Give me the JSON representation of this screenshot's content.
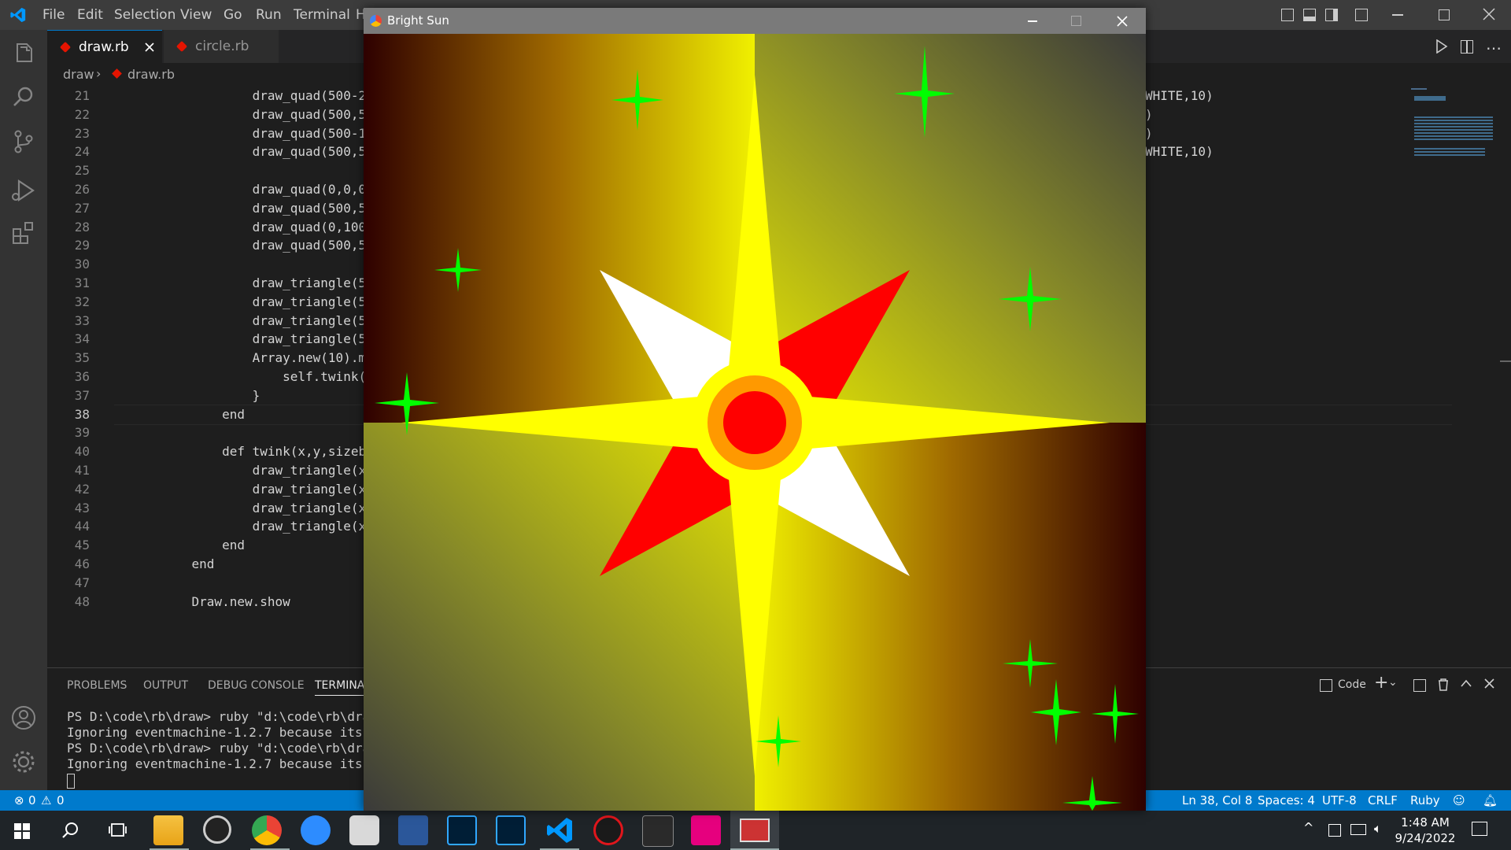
{
  "menu": [
    "File",
    "Edit",
    "Selection",
    "View",
    "Go",
    "Run",
    "Terminal",
    "H"
  ],
  "tabs": [
    {
      "label": "draw.rb",
      "active": true
    },
    {
      "label": "circle.rb",
      "active": false
    }
  ],
  "breadcrumb": {
    "folder": "draw",
    "file": "draw.rb"
  },
  "code": [
    {
      "n": "21",
      "t": "            draw_quad(500-200,500-200"
    },
    {
      "n": "22",
      "t": "            draw_quad(500,500-100,Gos"
    },
    {
      "n": "23",
      "t": "            draw_quad(500-100,500,Gos"
    },
    {
      "n": "24",
      "t": "            draw_quad(500,500,Gosu::C"
    },
    {
      "n": "25",
      "t": ""
    },
    {
      "n": "26",
      "t": "            draw_quad(0,0,0xff_330000"
    },
    {
      "n": "27",
      "t": "            draw_quad(500,500,Gosu::C"
    },
    {
      "n": "28",
      "t": "            draw_quad(0,1000,0xff_333"
    },
    {
      "n": "29",
      "t": "            draw_quad(500,500,Gosu::C"
    },
    {
      "n": "30",
      "t": ""
    },
    {
      "n": "31",
      "t": "            draw_triangle(500,500-50,"
    },
    {
      "n": "32",
      "t": "            draw_triangle(500-50,500,"
    },
    {
      "n": "33",
      "t": "            draw_triangle(500,500-50,"
    },
    {
      "n": "34",
      "t": "            draw_triangle(500-50,500,"
    },
    {
      "n": "35",
      "t": "            Array.new(10).map() {"
    },
    {
      "n": "36",
      "t": "                self.twink(rand(0..10"
    },
    {
      "n": "37",
      "t": "            }"
    },
    {
      "n": "38",
      "t": "        end"
    },
    {
      "n": "39",
      "t": ""
    },
    {
      "n": "40",
      "t": "        def twink(x,y,sizebase,sizehe"
    },
    {
      "n": "41",
      "t": "            draw_triangle(x,y-sizebas"
    },
    {
      "n": "42",
      "t": "            draw_triangle(x-sizebase,"
    },
    {
      "n": "43",
      "t": "            draw_triangle(x,y-sizebas"
    },
    {
      "n": "44",
      "t": "            draw_triangle(x-sizebase,"
    },
    {
      "n": "45",
      "t": "        end"
    },
    {
      "n": "46",
      "t": "    end"
    },
    {
      "n": "47",
      "t": ""
    },
    {
      "n": "48",
      "t": "    Draw.new.show"
    }
  ],
  "code_right": [
    {
      "n": "21",
      "t": "WHITE,10)"
    },
    {
      "n": "22",
      "t": ")"
    },
    {
      "n": "23",
      "t": ")"
    },
    {
      "n": "24",
      "t": "WHITE,10)"
    }
  ],
  "panel_tabs": [
    "PROBLEMS",
    "OUTPUT",
    "DEBUG CONSOLE",
    "TERMINAL"
  ],
  "panel_shell": "Code",
  "terminal": [
    "PS D:\\code\\rb\\draw> ruby \"d:\\code\\rb\\draw\\",
    "Ignoring eventmachine-1.2.7 because its ex",
    "PS D:\\code\\rb\\draw> ruby \"d:\\code\\rb\\draw\\",
    "Ignoring eventmachine-1.2.7 because its ex"
  ],
  "status": {
    "errors": "0",
    "warnings": "0",
    "position": "Ln 38, Col 8",
    "spaces": "Spaces: 4",
    "encoding": "UTF-8",
    "eol": "CRLF",
    "language": "Ruby"
  },
  "gosu_window": {
    "title": "Bright Sun"
  },
  "clock": {
    "time": "1:48 AM",
    "date": "9/24/2022"
  },
  "colors": {
    "accent": "#007acc",
    "star_yellow": "#ffff00",
    "star_red": "#ff0000",
    "sparkle": "#00ff00"
  }
}
